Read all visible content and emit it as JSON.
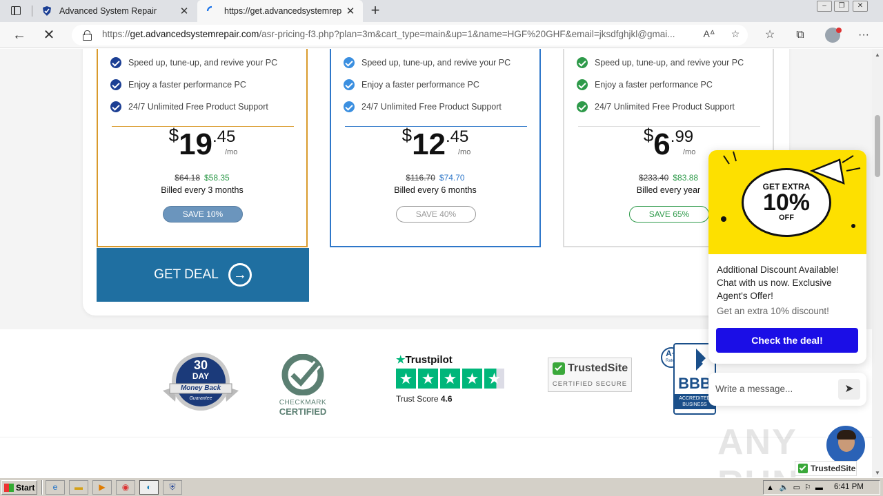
{
  "browser": {
    "tabs": [
      {
        "title": "Advanced System Repair",
        "active": false
      },
      {
        "title": "https://get.advancedsystemrepai",
        "active": true
      }
    ],
    "url_domain": "get.advancedsystemrepair.com",
    "url_prefix": "https://",
    "url_path": "/asr-pricing-f3.php?plan=3m&cart_type=main&up=1&name=HGF%20GHF&email=jksdfghjkl@gmai..."
  },
  "plans": [
    {
      "features": [
        "Speed up, tune-up, and revive your PC",
        "Enjoy a faster performance PC",
        "24/7 Unlimited Free Product Support"
      ],
      "currency": "$",
      "price_int": "19",
      "price_cents": ".45",
      "per": "/mo",
      "old_price": "$64.18",
      "new_price": "$58.35",
      "billed": "Billed every 3 months",
      "save": "SAVE 10%",
      "accent": "#d99a2b"
    },
    {
      "features": [
        "Speed up, tune-up, and revive your PC",
        "Enjoy a faster performance PC",
        "24/7 Unlimited Free Product Support"
      ],
      "currency": "$",
      "price_int": "12",
      "price_cents": ".45",
      "per": "/mo",
      "old_price": "$116.70",
      "new_price": "$74.70",
      "billed": "Billed every 6 months",
      "save": "SAVE 40%",
      "accent": "#2e77c9"
    },
    {
      "features": [
        "Speed up, tune-up, and revive your PC",
        "Enjoy a faster performance PC",
        "24/7 Unlimited Free Product Support"
      ],
      "currency": "$",
      "price_int": "6",
      "price_cents": ".99",
      "per": "/mo",
      "old_price": "$233.40",
      "new_price": "$83.88",
      "billed": "Billed every year",
      "save": "SAVE 65%",
      "accent": "#2e9a4a"
    }
  ],
  "get_deal": "GET DEAL",
  "badges": {
    "money_back_l1": "30",
    "money_back_l2": "DAY",
    "money_back_l3": "Money Back",
    "money_back_l4": "Guarantee",
    "checkmark_l1": "CHECKMARK",
    "checkmark_l2": "CERTIFIED",
    "trustpilot": "Trustpilot",
    "trust_score_label": "Trust Score",
    "trust_score": "4.6",
    "trustedsite": "TrustedSite",
    "trustedsite_sub": "CERTIFIED SECURE",
    "bbb_rating": "A+",
    "bbb_rated": "Rated",
    "bbb": "BBB",
    "bbb_sub1": "ACCREDITED",
    "bbb_sub2": "BUSINESS"
  },
  "chat": {
    "promo_l1": "GET EXTRA",
    "promo_l2": "10%",
    "promo_l3": "OFF",
    "message": "Additional Discount Available! Chat with us now. Exclusive Agent's Offer!",
    "sub": "Get an extra 10% discount!",
    "button": "Check the deal!",
    "placeholder": "Write a message..."
  },
  "trustedsite_float": "TrustedSite",
  "watermark": "ANY RUN",
  "taskbar": {
    "start": "Start",
    "time": "6:41 PM"
  },
  "colors": {
    "get_deal_bg": "#1f6fa1",
    "chat_button": "#1b0ee6",
    "promo_bg": "#fde000"
  }
}
